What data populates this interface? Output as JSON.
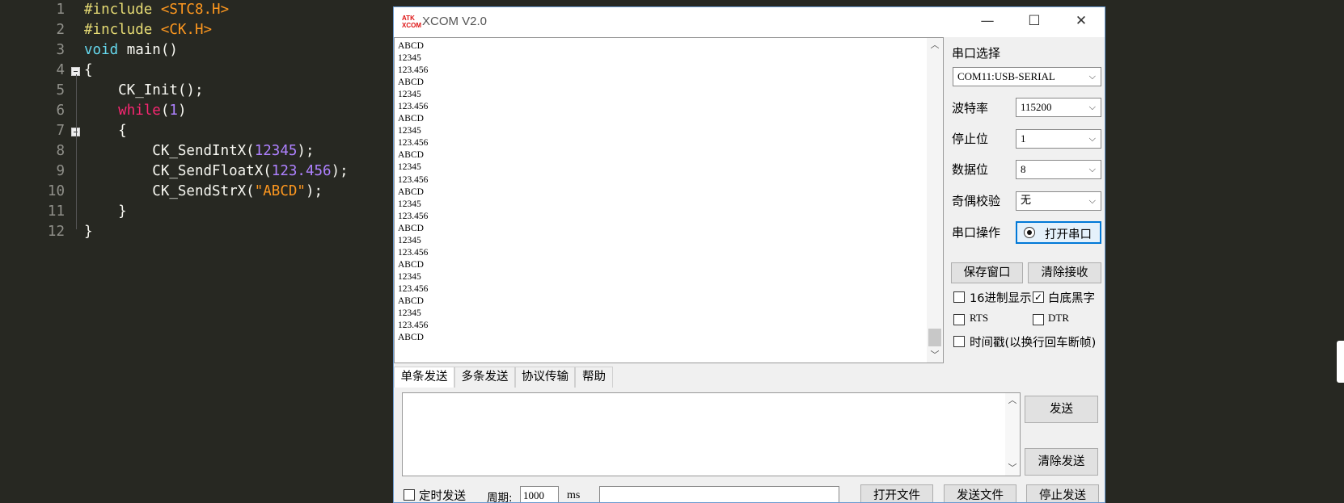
{
  "editor": {
    "lines": [
      {
        "n": "1",
        "parts": [
          [
            "#include ",
            "y"
          ],
          [
            "<STC8.H>",
            "o"
          ]
        ]
      },
      {
        "n": "2",
        "parts": [
          [
            "#include ",
            "y"
          ],
          [
            "<CK.H>",
            "o"
          ]
        ]
      },
      {
        "n": "3",
        "parts": [
          [
            "void ",
            "c"
          ],
          [
            "main()",
            "w"
          ]
        ]
      },
      {
        "n": "4",
        "parts": [
          [
            "{",
            "w"
          ]
        ]
      },
      {
        "n": "5",
        "parts": [
          [
            "    CK_Init();",
            "w"
          ]
        ]
      },
      {
        "n": "6",
        "parts": [
          [
            "    ",
            "w"
          ],
          [
            "while",
            "r"
          ],
          [
            "(",
            "w"
          ],
          [
            "1",
            "p"
          ],
          [
            ")",
            "w"
          ]
        ]
      },
      {
        "n": "7",
        "parts": [
          [
            "    {",
            "w"
          ]
        ]
      },
      {
        "n": "8",
        "parts": [
          [
            "        CK_SendIntX(",
            "w"
          ],
          [
            "12345",
            "p"
          ],
          [
            ");",
            "w"
          ]
        ]
      },
      {
        "n": "9",
        "parts": [
          [
            "        CK_SendFloatX(",
            "w"
          ],
          [
            "123.456",
            "p"
          ],
          [
            ");",
            "w"
          ]
        ]
      },
      {
        "n": "10",
        "parts": [
          [
            "        CK_SendStrX(",
            "w"
          ],
          [
            "\"ABCD\"",
            "o"
          ],
          [
            ");",
            "w"
          ]
        ]
      },
      {
        "n": "11",
        "parts": [
          [
            "    }",
            "w"
          ]
        ]
      },
      {
        "n": "12",
        "parts": [
          [
            "}",
            "w"
          ]
        ]
      }
    ]
  },
  "xcom": {
    "logo_top": "ATK",
    "logo_bottom": "XCOM",
    "title": "XCOM V2.0",
    "min_icon": "—",
    "max_icon": "☐",
    "close_icon": "✕",
    "received": [
      "ABCD",
      "12345",
      "123.456",
      "ABCD",
      "12345",
      "123.456",
      "ABCD",
      "12345",
      "123.456",
      "ABCD",
      "12345",
      "123.456",
      "ABCD",
      "12345",
      "123.456",
      "ABCD",
      "12345",
      "123.456",
      "ABCD",
      "12345",
      "123.456",
      "ABCD",
      "12345",
      "123.456",
      "ABCD"
    ],
    "port_select_label": "串口选择",
    "port_value": "COM11:USB-SERIAL",
    "baud_label": "波特率",
    "baud_value": "115200",
    "stop_label": "停止位",
    "stop_value": "1",
    "data_label": "数据位",
    "data_value": "8",
    "parity_label": "奇偶校验",
    "parity_value": "无",
    "port_op_label": "串口操作",
    "open_port_button": "打开串口",
    "save_window_button": "保存窗口",
    "clear_recv_button": "清除接收",
    "hex_display_label": "16进制显示",
    "hex_display_checked": false,
    "white_black_label": "白底黑字",
    "white_black_checked": true,
    "rts_label": "RTS",
    "dtr_label": "DTR",
    "timestamp_label": "时间戳(以换行回车断帧)",
    "tabs": [
      "单条发送",
      "多条发送",
      "协议传输",
      "帮助"
    ],
    "send_button": "发送",
    "clear_send_button": "清除发送",
    "timed_send_label": "定时发送",
    "period_label": "周期:",
    "period_value": "1000",
    "ms_label": "ms",
    "open_file_button": "打开文件",
    "send_file_button": "发送文件",
    "stop_send_button": "停止发送"
  }
}
